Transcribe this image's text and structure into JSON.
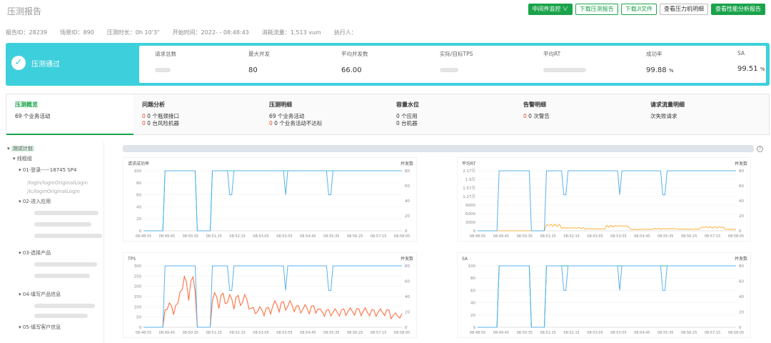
{
  "header": {
    "title": "压测报告",
    "buttons": [
      "中间件监控 ∨",
      "下载压测报告",
      "下载JI文件",
      "查看压力机明细",
      "查看性能分析报告"
    ]
  },
  "meta": {
    "report_id": "报告ID：28239",
    "scene_id": "场景ID：890",
    "duration": "压测时长：0h 10'3\"",
    "start": "开始时间：2022- - 08:48:43",
    "flow": "消耗流量：1,513 vum",
    "executor": "执行人："
  },
  "kpi": {
    "status": "压测通过",
    "items": [
      {
        "label": "请求总数",
        "value": ""
      },
      {
        "label": "最大并发",
        "value": "80"
      },
      {
        "label": "平均并发数",
        "value": "66.00"
      },
      {
        "label": "实际/目标TPS",
        "value": ""
      },
      {
        "label": "平均RT",
        "value": ""
      },
      {
        "label": "成功率",
        "value": "99.88",
        "unit": "%"
      },
      {
        "label": "SA",
        "value": "99.51",
        "unit": "%"
      }
    ]
  },
  "tabs": [
    {
      "title": "压测概览",
      "l1": "69 个业务活动",
      "l2": ""
    },
    {
      "title": "问题分析",
      "l1": "0 个瓶颈接口",
      "l2": "0 台风险机器"
    },
    {
      "title": "压测明细",
      "l1": "69 个业务活动",
      "l2": "0 个业务活动不达标"
    },
    {
      "title": "容量水位",
      "l1": "0 个应用",
      "l2": "0 台机器"
    },
    {
      "title": "告警明细",
      "l1": "0 次警告",
      "l2": ""
    },
    {
      "title": "请求流量明细",
      "l1": "次失败请求",
      "l2": ""
    }
  ],
  "tree": {
    "root": "测试计划",
    "group": "线程组",
    "items": [
      "01-登录-----18745 SP4",
      "02-进入应用",
      "03-选择产品",
      "04-填写产品信息",
      "05-填写客户信息"
    ],
    "sub": [
      "/login/loginOriginalLogin",
      "/lc/loginOriginalLogin"
    ]
  },
  "chart_common": {
    "times": [
      "08:48:55",
      "08:49:45",
      "08:50:35",
      "08:51:25",
      "08:52:15",
      "08:53:05",
      "08:53:55",
      "08:54:45",
      "08:55:35",
      "08:56:25",
      "08:57:15",
      "08:58:05"
    ],
    "right_label": "并发数",
    "right_ticks": [
      "80",
      "60",
      "40",
      "20",
      "0"
    ]
  },
  "chart_data": [
    {
      "type": "line",
      "title": "请求成功率",
      "y_ticks": [
        "100",
        "80",
        "60",
        "40",
        "20",
        "0"
      ],
      "ylim": [
        0,
        100
      ],
      "series": [
        {
          "name": "请求成功率",
          "color": "#2ec7c9",
          "values": [
            100,
            100,
            100,
            100,
            100,
            100,
            100,
            100,
            100,
            100,
            100,
            100
          ]
        },
        {
          "name": "并发数",
          "color": "#5ab1ef",
          "values": [
            80,
            80,
            80,
            80,
            80,
            80,
            80,
            80,
            80,
            80,
            80,
            80
          ]
        }
      ]
    },
    {
      "type": "line",
      "title": "平均RT",
      "y_ticks": [
        "2.17万",
        "1.9万",
        "1.57万",
        "1.27万",
        "9000",
        "6000",
        "3000",
        "0"
      ],
      "ylim": [
        0,
        21700
      ],
      "series": [
        {
          "name": "平均RT",
          "color": "#ffb74d",
          "values": [
            0,
            0,
            0,
            2400,
            1200,
            800,
            2000,
            600,
            900,
            700,
            1500,
            600
          ]
        },
        {
          "name": "并发数",
          "color": "#5ab1ef",
          "values": [
            80,
            80,
            80,
            80,
            80,
            80,
            80,
            80,
            80,
            80,
            80,
            80
          ]
        }
      ]
    },
    {
      "type": "line",
      "title": "TPS",
      "y_ticks": [
        "300",
        "250",
        "200",
        "150",
        "100",
        "50",
        "0"
      ],
      "ylim": [
        0,
        300
      ],
      "series": [
        {
          "name": "TPS",
          "color": "#ff7043",
          "values": [
            0,
            120,
            250,
            170,
            160,
            100,
            130,
            110,
            90,
            95,
            90,
            70
          ]
        },
        {
          "name": "并发数",
          "color": "#5ab1ef",
          "values": [
            80,
            80,
            80,
            80,
            80,
            80,
            80,
            80,
            80,
            80,
            80,
            80
          ]
        }
      ]
    },
    {
      "type": "line",
      "title": "SA",
      "y_ticks": [
        "100",
        "80",
        "60",
        "40",
        "20",
        "0"
      ],
      "ylim": [
        0,
        100
      ],
      "series": [
        {
          "name": "SA",
          "color": "#26b99a",
          "values": [
            100,
            100,
            100,
            100,
            100,
            100,
            100,
            100,
            100,
            100,
            100,
            100
          ]
        },
        {
          "name": "并发数",
          "color": "#5ab1ef",
          "values": [
            80,
            80,
            80,
            80,
            80,
            80,
            80,
            80,
            80,
            80,
            80,
            80
          ]
        }
      ]
    }
  ]
}
